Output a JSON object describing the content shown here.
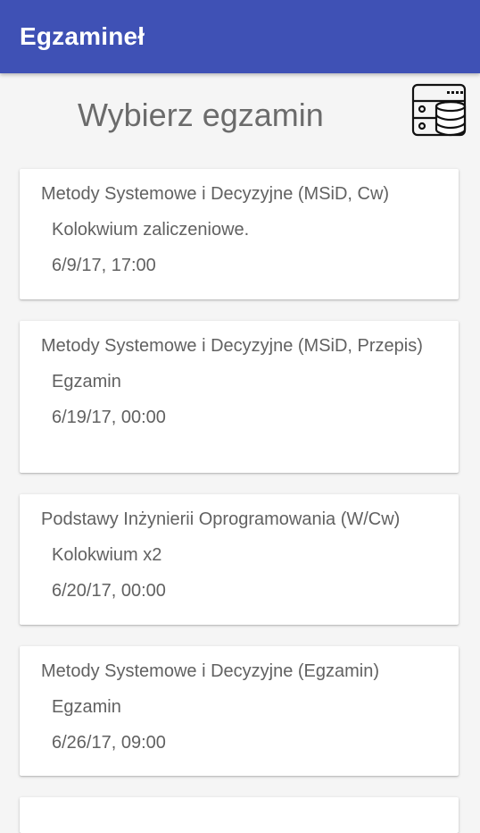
{
  "appbar": {
    "title": "Egzamineł",
    "color": "#3f51b5"
  },
  "header": {
    "title": "Wybierz egzamin",
    "action_icon": "database-server-icon"
  },
  "exams": [
    {
      "title": "Metody Systemowe i Decyzyjne (MSiD, Cw)",
      "description": "Kolokwium zaliczeniowe.",
      "date": "6/9/17, 17:00"
    },
    {
      "title": "Metody Systemowe i Decyzyjne (MSiD, Przepis)",
      "description": "Egzamin",
      "date": "6/19/17, 00:00"
    },
    {
      "title": "Podstawy Inżynierii Oprogramowania (W/Cw)",
      "description": "Kolokwium x2",
      "date": "6/20/17, 00:00"
    },
    {
      "title": "Metody Systemowe i Decyzyjne (Egzamin)",
      "description": "Egzamin",
      "date": "6/26/17, 09:00"
    }
  ]
}
